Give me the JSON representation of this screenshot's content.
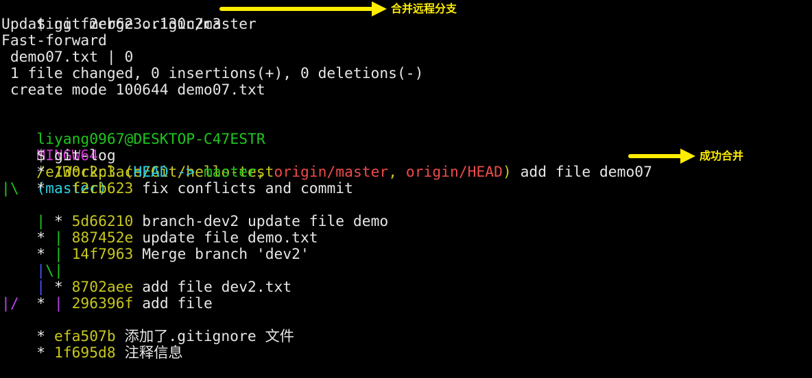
{
  "terminal": {
    "l0": {
      "prompt": "$ ",
      "command": "git merge origin/master"
    },
    "l1": "Updating f2cb623..130c2c3",
    "l2": "Fast-forward",
    "l3": " demo07.txt | 0",
    "l4": " 1 file changed, 0 insertions(+), 0 deletions(-)",
    "l5": " create mode 100644 demo07.txt",
    "l7": {
      "user_host": "liyang0967@DESKTOP-C47ESTR",
      "env": "MINGW64",
      "path": "/e/Workplace/Git/hello-test",
      "branch": "(master)"
    },
    "l8": {
      "prompt": "$ ",
      "command": "git-log"
    },
    "l9": {
      "graph": "* ",
      "hash": "130c2c3",
      "paren_open": "(",
      "head": "HEAD -> ",
      "local_branch": "master",
      "sep1": ", ",
      "remote_branch": "origin/master",
      "sep2": ", ",
      "remote_head": "origin/HEAD",
      "paren_close": ")",
      "message": " add file demo07"
    },
    "l10": {
      "graph": "*   ",
      "hash": "f2cb623",
      "message": " fix conflicts and commit"
    },
    "l11": {
      "graph": "|\\"
    },
    "l12": {
      "graph_a": "| ",
      "graph_b": "* ",
      "hash": "5d66210",
      "message": " branch-dev2 update file demo"
    },
    "l13": {
      "graph_a": "* ",
      "graph_b": "| ",
      "hash": "887452e",
      "message": " update file demo.txt"
    },
    "l14": {
      "graph_a": "* ",
      "graph_b": "| ",
      "hash": "14f7963",
      "message": " Merge branch 'dev2'"
    },
    "l15": {
      "graph_a": "|",
      "graph_b": "\\|"
    },
    "l16": {
      "graph_a": "| ",
      "graph_b": "* ",
      "hash": "8702aee",
      "message": " add file dev2.txt"
    },
    "l17": {
      "graph_a": "* ",
      "graph_b": "| ",
      "hash": "296396f",
      "message": " add file"
    },
    "l18": {
      "graph": "|/"
    },
    "l19": {
      "graph": "* ",
      "hash": "efa507b",
      "message": " 添加了.gitignore 文件"
    },
    "l20": {
      "graph": "* ",
      "hash": "1f695d8",
      "message": " 注释信息"
    }
  },
  "annotations": {
    "merge_note": "合并远程分支",
    "success_note": "成功合并",
    "arrow_color": "#ffee00"
  }
}
